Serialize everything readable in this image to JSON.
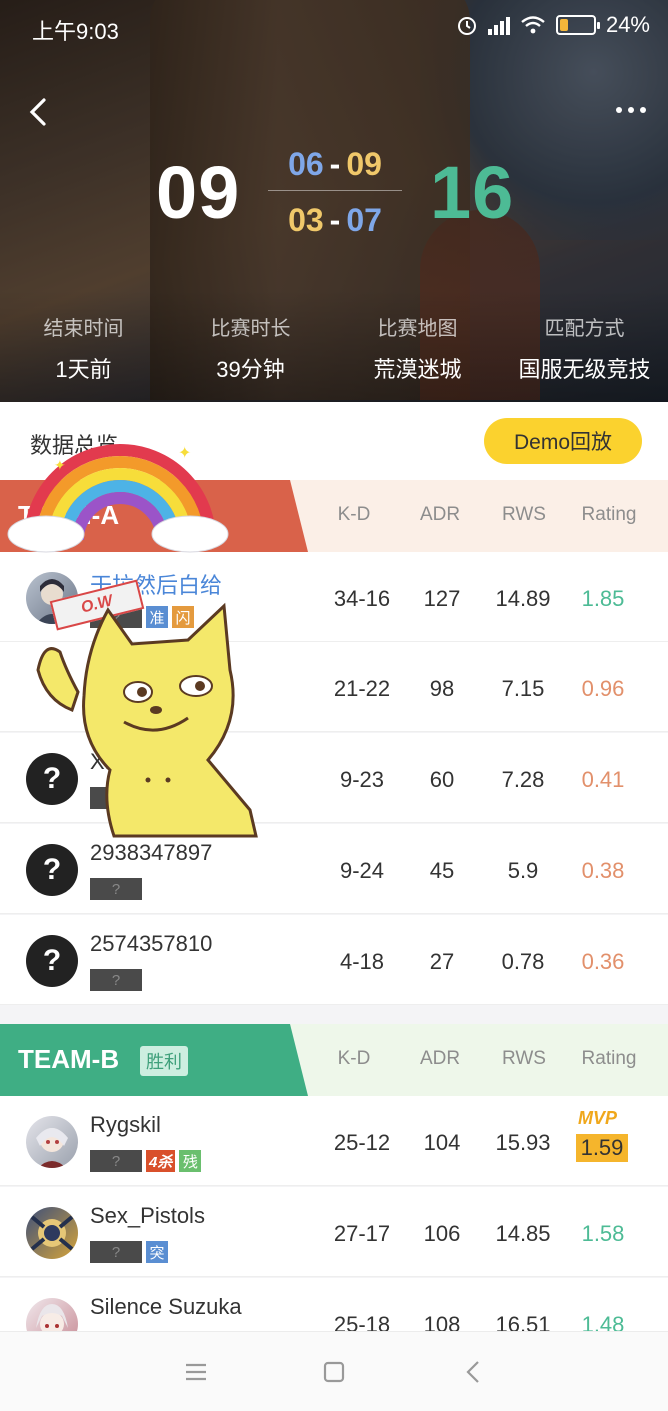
{
  "status_bar": {
    "time": "上午9:03",
    "battery": "24%",
    "battery_level": 0.24
  },
  "colors": {
    "ct": "#d9624a",
    "t": "#3fae84",
    "accent": "#fbd22e",
    "good": "#4dbb95",
    "bad": "#e2906b"
  },
  "header": {
    "back_icon": "chevron-left-icon",
    "more_icon": "more-horizontal-icon",
    "score_left": "09",
    "score_right": "16",
    "half1": {
      "a": "06",
      "b": "09"
    },
    "half2": {
      "a": "03",
      "b": "07"
    },
    "dash": "-"
  },
  "info": [
    {
      "label": "结束时间",
      "value": "1天前"
    },
    {
      "label": "比赛时长",
      "value": "39分钟"
    },
    {
      "label": "比赛地图",
      "value": "荒漠迷城"
    },
    {
      "label": "匹配方式",
      "value": "国服无级竞技"
    }
  ],
  "overview": {
    "title": "数据总览",
    "demo_label": "Demo回放"
  },
  "columns": {
    "kd": "K-D",
    "adr": "ADR",
    "rws": "RWS",
    "rating": "Rating"
  },
  "team_a": {
    "name": "TEAM-A",
    "players": [
      {
        "name": "干拉然后白给",
        "badges": [
          "准",
          "闪"
        ],
        "kd": "34-16",
        "adr": "127",
        "rws": "14.89",
        "rating": "1.85"
      },
      {
        "name": "",
        "badges": [],
        "kd": "21-22",
        "adr": "98",
        "rws": "7.15",
        "rating": "0.96"
      },
      {
        "name": "XL",
        "badges": [],
        "kd": "9-23",
        "adr": "60",
        "rws": "7.28",
        "rating": "0.41"
      },
      {
        "name": "2938347897",
        "badges": [],
        "kd": "9-24",
        "adr": "45",
        "rws": "5.9",
        "rating": "0.38"
      },
      {
        "name": "2574357810",
        "badges": [],
        "kd": "4-18",
        "adr": "27",
        "rws": "0.78",
        "rating": "0.36"
      }
    ]
  },
  "team_b": {
    "name": "TEAM-B",
    "result": "胜利",
    "mvp_label": "MVP",
    "players": [
      {
        "name": "Rygskil",
        "badges": [
          "4杀",
          "残"
        ],
        "kd": "25-12",
        "adr": "104",
        "rws": "15.93",
        "rating": "1.59"
      },
      {
        "name": "Sex_Pistols",
        "badges": [
          "突"
        ],
        "kd": "27-17",
        "adr": "106",
        "rws": "14.85",
        "rating": "1.58"
      },
      {
        "name": "Silence Suzuka",
        "badges": [],
        "kd": "25-18",
        "adr": "108",
        "rws": "16.51",
        "rating": "1.48"
      }
    ]
  },
  "stickers": {
    "stamp": "O.W"
  },
  "nav": {
    "menu_icon": "menu-icon",
    "home_icon": "square-icon",
    "back_icon": "triangle-back-icon"
  }
}
